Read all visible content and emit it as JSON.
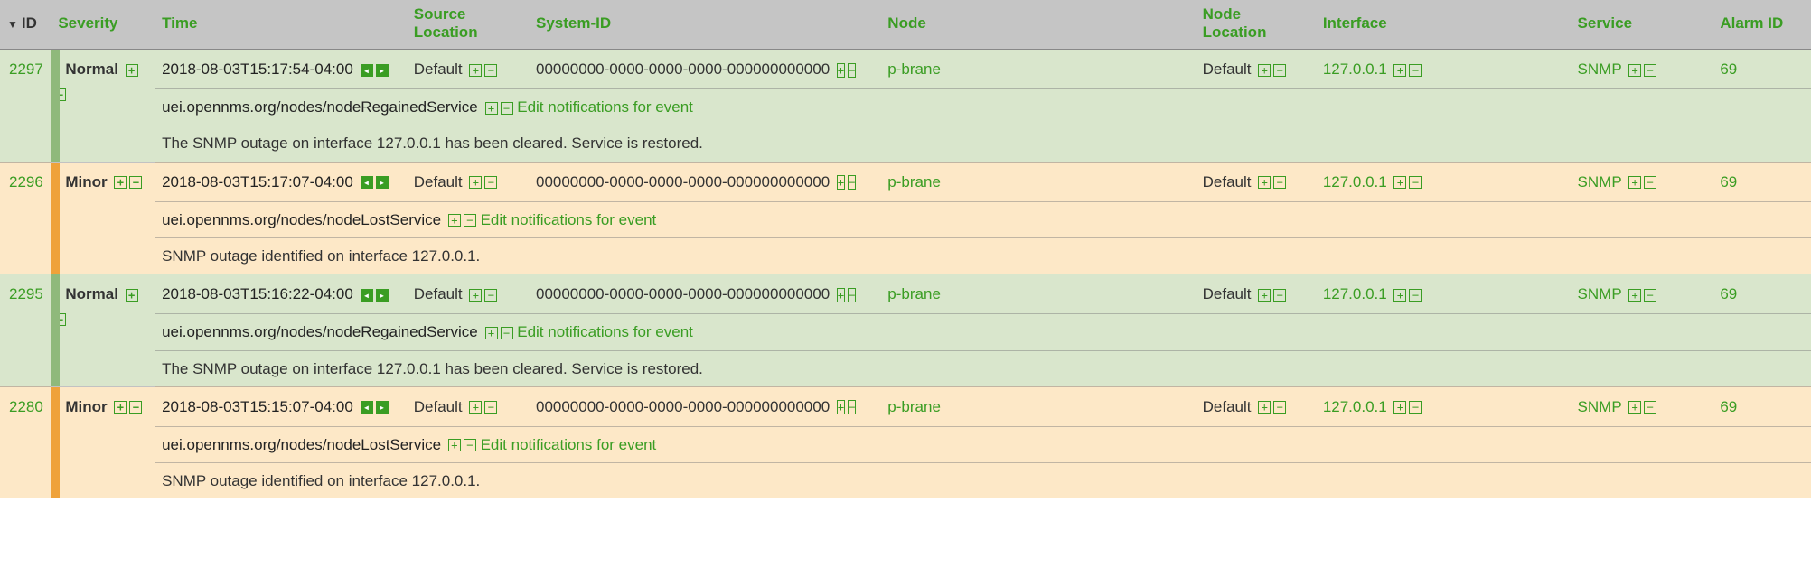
{
  "headers": {
    "id": "ID",
    "severity": "Severity",
    "time": "Time",
    "source_location": "Source Location",
    "system_id": "System-ID",
    "node": "Node",
    "node_location": "Node Location",
    "interface": "Interface",
    "service": "Service",
    "alarm_id": "Alarm ID"
  },
  "rows": [
    {
      "id": "2297",
      "severity": "Normal",
      "severity_class": "normal",
      "time": "2018-08-03T15:17:54-04:00",
      "source_location": "Default",
      "system_id": "00000000-0000-0000-0000-000000000000",
      "node": "p-brane",
      "node_location": "Default",
      "interface": "127.0.0.1",
      "service": "SNMP",
      "alarm_id": "69",
      "uei": "uei.opennms.org/nodes/nodeRegainedService",
      "edit_link": "Edit notifications for event",
      "message": "The SNMP outage on interface 127.0.0.1 has been cleared. Service is restored."
    },
    {
      "id": "2296",
      "severity": "Minor",
      "severity_class": "minor",
      "time": "2018-08-03T15:17:07-04:00",
      "source_location": "Default",
      "system_id": "00000000-0000-0000-0000-000000000000",
      "node": "p-brane",
      "node_location": "Default",
      "interface": "127.0.0.1",
      "service": "SNMP",
      "alarm_id": "69",
      "uei": "uei.opennms.org/nodes/nodeLostService",
      "edit_link": "Edit notifications for event",
      "message": "SNMP outage identified on interface 127.0.0.1."
    },
    {
      "id": "2295",
      "severity": "Normal",
      "severity_class": "normal",
      "time": "2018-08-03T15:16:22-04:00",
      "source_location": "Default",
      "system_id": "00000000-0000-0000-0000-000000000000",
      "node": "p-brane",
      "node_location": "Default",
      "interface": "127.0.0.1",
      "service": "SNMP",
      "alarm_id": "69",
      "uei": "uei.opennms.org/nodes/nodeRegainedService",
      "edit_link": "Edit notifications for event",
      "message": "The SNMP outage on interface 127.0.0.1 has been cleared. Service is restored."
    },
    {
      "id": "2280",
      "severity": "Minor",
      "severity_class": "minor",
      "time": "2018-08-03T15:15:07-04:00",
      "source_location": "Default",
      "system_id": "00000000-0000-0000-0000-000000000000",
      "node": "p-brane",
      "node_location": "Default",
      "interface": "127.0.0.1",
      "service": "SNMP",
      "alarm_id": "69",
      "uei": "uei.opennms.org/nodes/nodeLostService",
      "edit_link": "Edit notifications for event",
      "message": "SNMP outage identified on interface 127.0.0.1."
    }
  ]
}
